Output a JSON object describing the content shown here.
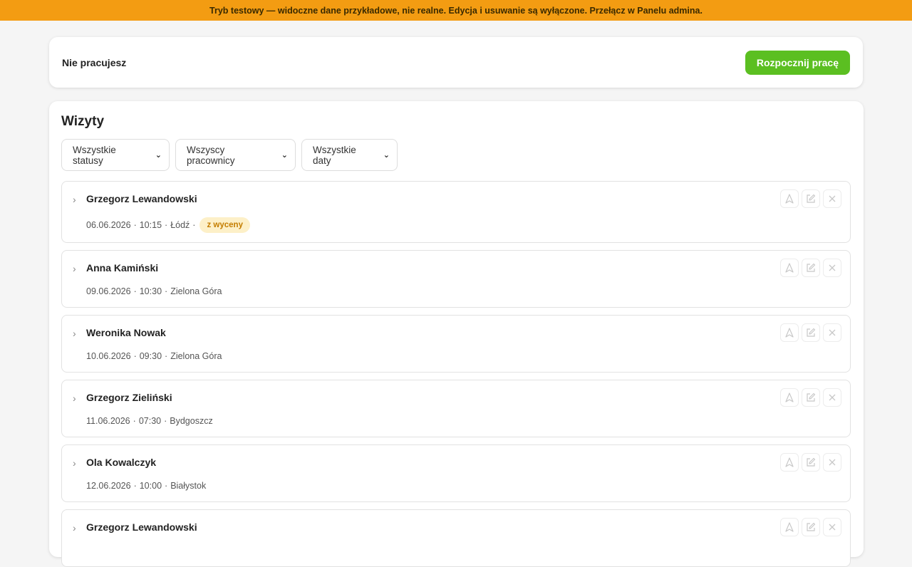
{
  "banner": {
    "text": "Tryb testowy — widoczne dane przykładowe, nie realne. Edycja i usuwanie są wyłączone. Przełącz w Panelu admina."
  },
  "status": {
    "text": "Nie pracujesz",
    "start_label": "Rozpocznij pracę"
  },
  "visits": {
    "title": "Wizyty",
    "filters": {
      "status": "Wszystkie statusy",
      "workers": "Wszyscy pracownicy",
      "dates": "Wszystkie daty"
    },
    "items": [
      {
        "name": "Grzegorz Lewandowski",
        "date": "06.06.2026",
        "time": "10:15",
        "city": "Łódź",
        "badge": "z wyceny"
      },
      {
        "name": "Anna Kamiński",
        "date": "09.06.2026",
        "time": "10:30",
        "city": "Zielona Góra"
      },
      {
        "name": "Weronika Nowak",
        "date": "10.06.2026",
        "time": "09:30",
        "city": "Zielona Góra"
      },
      {
        "name": "Grzegorz Zieliński",
        "date": "11.06.2026",
        "time": "07:30",
        "city": "Bydgoszcz"
      },
      {
        "name": "Ola Kowalczyk",
        "date": "12.06.2026",
        "time": "10:00",
        "city": "Białystok"
      },
      {
        "name": "Grzegorz Lewandowski"
      }
    ]
  },
  "colors": {
    "banner": "#f39c12",
    "start_button": "#5bbf21",
    "badge_bg": "#fdf0c8",
    "badge_text": "#c47d00"
  },
  "icons": {
    "toggle": "chevron-right-icon",
    "navigate": "navigation-arrow-icon",
    "edit": "edit-icon",
    "delete": "close-icon"
  }
}
